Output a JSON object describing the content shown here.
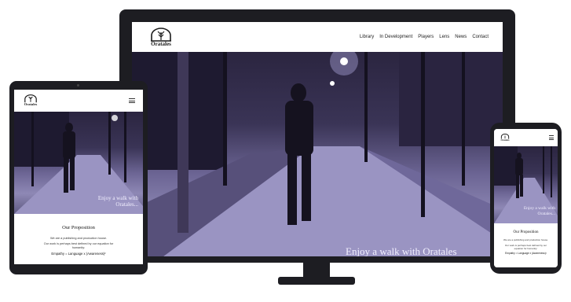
{
  "brand": {
    "name": "Oratales"
  },
  "nav": [
    {
      "label": "Library"
    },
    {
      "label": "In Development"
    },
    {
      "label": "Players"
    },
    {
      "label": "Lens"
    },
    {
      "label": "News"
    },
    {
      "label": "Contact"
    }
  ],
  "hero": {
    "desktop_caption": "Enjoy a walk with Oratales",
    "tablet_caption": "Enjoy a walk with Oratales...",
    "phone_caption": "Enjoy a walk with Oratales..."
  },
  "proposition": {
    "title": "Our Proposition",
    "text1": "We are a publishing and production house.",
    "text2": "Our work is perhaps best defined by our equation for humanity:",
    "equation": "Empathy = Language x (Awareness)²"
  },
  "colors": {
    "device_frame": "#1d1d22",
    "hero_tint": "#6c6594",
    "caption": "#f2f0ff"
  },
  "icons": {
    "logo": "oak-leaf-arch-logo",
    "menu": "hamburger-icon"
  }
}
